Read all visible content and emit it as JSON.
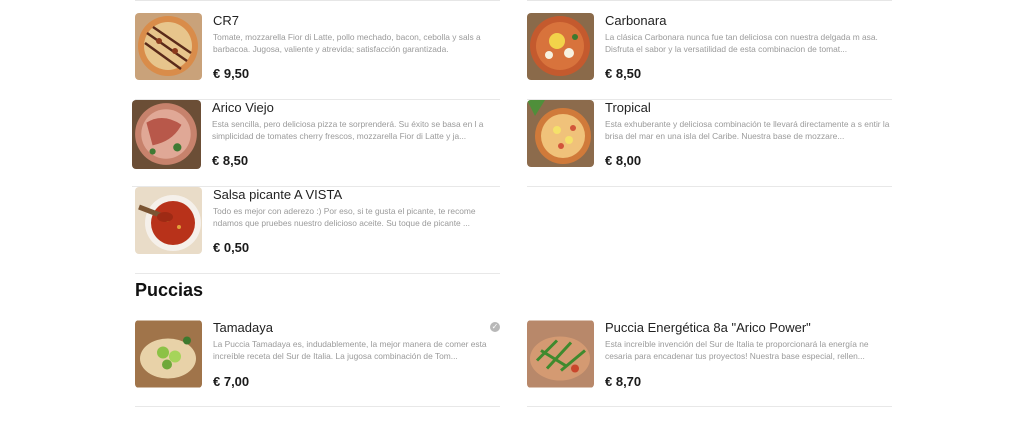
{
  "sections": [
    {
      "items": [
        {
          "name": "CR7",
          "description": "Tomate, mozzarella Fior di Latte, pollo mechado, bacon, cebolla y sals a barbacoa. Jugosa, valiente y atrevida; satisfacción garantizada.",
          "price": "€ 9,50"
        },
        {
          "name": "Carbonara",
          "description": "La clásica Carbonara nunca fue tan deliciosa con nuestra delgada m asa. Disfruta el sabor y la versatilidad de esta combinacion de tomat...",
          "price": "€ 8,50"
        },
        {
          "name": "Arico Viejo",
          "description": "Esta sencilla, pero deliciosa pizza te sorprenderá. Su éxito se basa en l a simplicidad de tomates cherry frescos, mozzarella Fior di Latte y ja...",
          "price": "€ 8,50"
        },
        {
          "name": "Tropical",
          "description": "Esta exhuberante y deliciosa combinación te llevará directamente a s entir la brisa del mar en una isla del Caribe. Nuestra base de mozzare...",
          "price": "€ 8,00"
        },
        {
          "name": "Salsa picante A VISTA",
          "description": "Todo es mejor con aderezo :) Por eso, si te gusta el picante, te recome ndamos que pruebes nuestro delicioso aceite. Su toque de picante ...",
          "price": "€ 0,50"
        }
      ]
    },
    {
      "title": "Puccias",
      "items": [
        {
          "name": "Tamadaya",
          "description": "La Puccia Tamadaya es, indudablemente, la mejor manera de comer esta increíble receta del Sur de Italia. La jugosa combinación de Tom...",
          "price": "€ 7,00",
          "badge_icon": "vegetarian-icon"
        },
        {
          "name": "Puccia Energética 8a \"Arico Power\"",
          "description": "Esta increíble invención del Sur de Italia te proporcionará la energía ne cesaria para encadenar tus proyectos! Nuestra base especial, rellen...",
          "price": "€ 8,70"
        }
      ]
    }
  ]
}
